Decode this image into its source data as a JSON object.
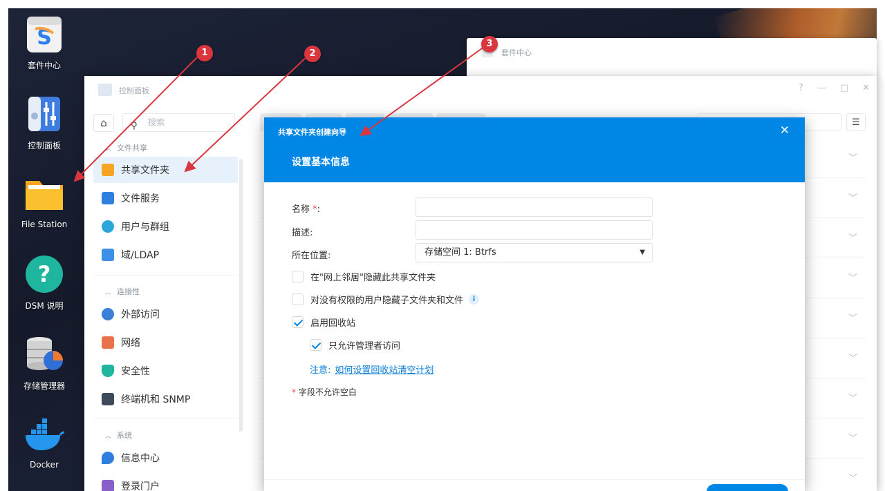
{
  "desktop": {
    "icons": [
      {
        "label": "套件中心"
      },
      {
        "label": "控制面板"
      },
      {
        "label": "File Station"
      },
      {
        "label": "DSM 说明"
      },
      {
        "label": "存储管理器"
      },
      {
        "label": "Docker"
      }
    ]
  },
  "back_window": {
    "title": "套件中心"
  },
  "control_panel": {
    "title": "控制面板",
    "window_buttons": {
      "help": "?",
      "minimize": "—",
      "maximize": "□",
      "close": "✕"
    },
    "search_placeholder": "搜索",
    "sections": [
      {
        "title": "文件共享",
        "items": [
          "共享文件夹",
          "文件服务",
          "用户与群组",
          "域/LDAP"
        ]
      },
      {
        "title": "连接性",
        "items": [
          "外部访问",
          "网络",
          "安全性",
          "终端机和 SNMP"
        ]
      },
      {
        "title": "系统",
        "items": [
          "信息中心",
          "登录门户"
        ]
      }
    ],
    "active_item": "共享文件夹"
  },
  "wizard": {
    "window_title": "共享文件夹创建向导",
    "step_title": "设置基本信息",
    "fields": {
      "name_label": "名称",
      "name_required_mark": "*",
      "name_colon": ":",
      "desc_label": "描述:",
      "location_label": "所在位置:",
      "location_value": "存储空间 1:  Btrfs"
    },
    "checkboxes": [
      {
        "label": "在\"网上邻居\"隐藏此共享文件夹",
        "checked": false
      },
      {
        "label": "对没有权限的用户隐藏子文件夹和文件",
        "checked": false
      },
      {
        "label": "启用回收站",
        "checked": true
      },
      {
        "label": "只允许管理者访问",
        "checked": true
      }
    ],
    "note_label": "注意:",
    "note_link": "如何设置回收站清空计划",
    "required_note_mark": "*",
    "required_note": "字段不允许空白"
  },
  "annotations": {
    "badges": [
      "1",
      "2",
      "3"
    ],
    "color": "#d9363e"
  },
  "colors": {
    "accent": "#0086e5",
    "required": "#e5484d",
    "link": "#0a7ed8"
  }
}
